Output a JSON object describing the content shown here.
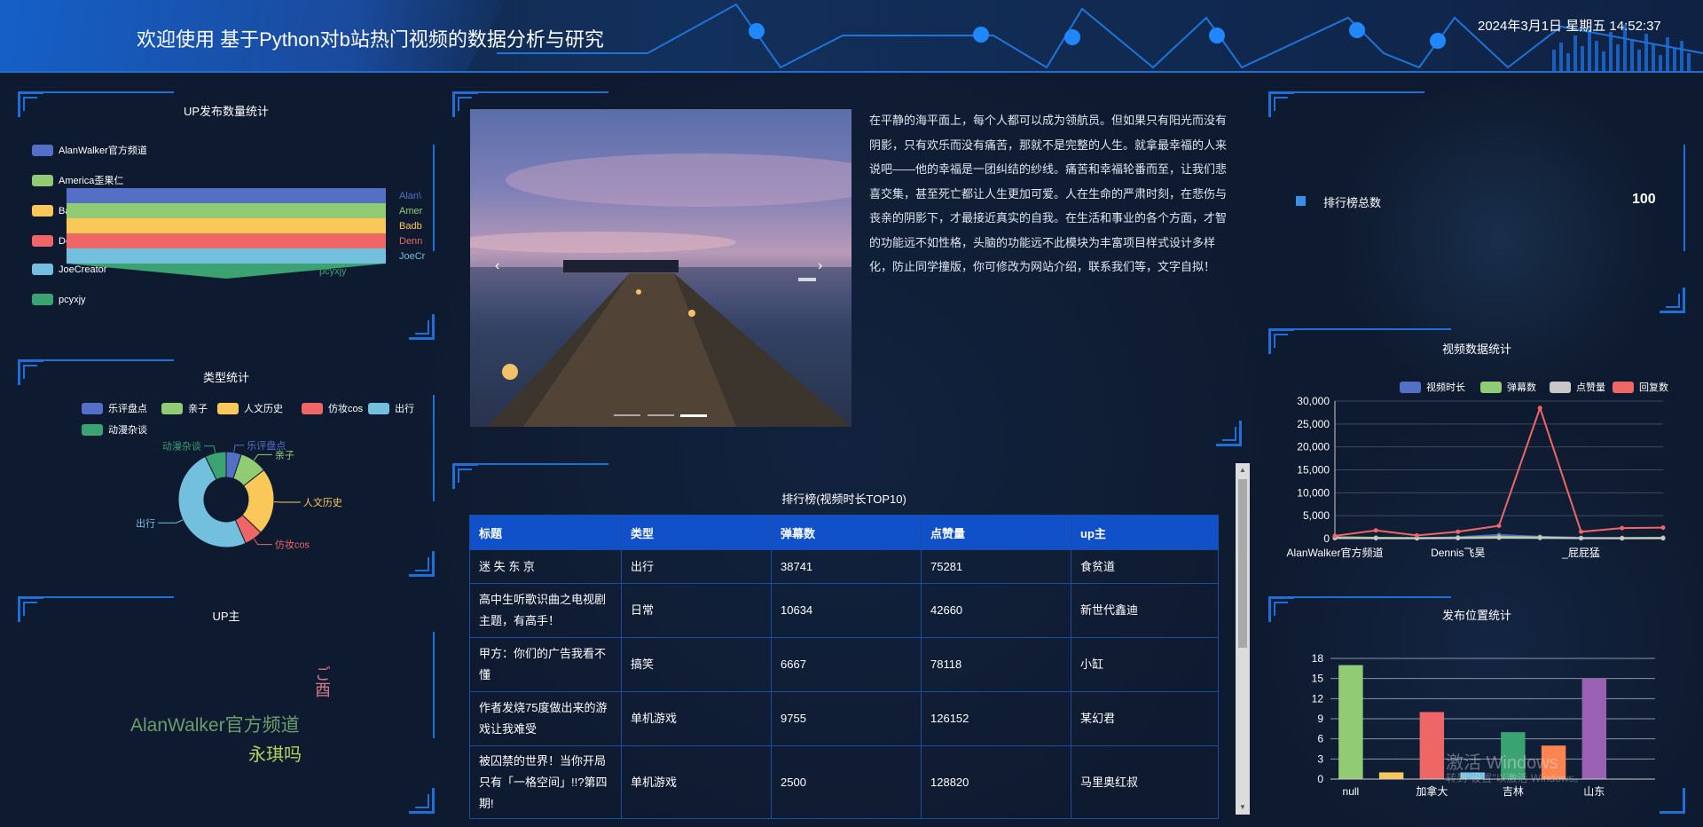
{
  "header": {
    "title": "欢迎使用 基于Python对b站热门视频的数据分析与研究",
    "datetime": "2024年3月1日 星期五 14:52:37"
  },
  "up_publish": {
    "title": "UP发布数量统计",
    "legend": [
      {
        "label": "AlanWalker官方频道",
        "color": "#5470c6"
      },
      {
        "label": "America歪果仁",
        "color": "#91cc75"
      },
      {
        "label": "Badboy猫主",
        "color": "#fac858"
      },
      {
        "label": "Dennis 飞昊",
        "color": "#ee6666"
      },
      {
        "label": "JoeCreator",
        "color": "#73c0de"
      },
      {
        "label": "pcyxjy",
        "color": "#3ba272"
      }
    ],
    "funnel_labels": [
      "Alan\\",
      "Amer",
      "Badb",
      "Denn",
      "JoeCr",
      "pcyxjy"
    ]
  },
  "type_stats": {
    "title": "类型统计",
    "legend": [
      {
        "label": "乐评盘点",
        "color": "#5470c6"
      },
      {
        "label": "亲子",
        "color": "#91cc75"
      },
      {
        "label": "人文历史",
        "color": "#fac858"
      },
      {
        "label": "仿妆cos",
        "color": "#ee6666"
      },
      {
        "label": "出行",
        "color": "#73c0de"
      },
      {
        "label": "动漫杂谈",
        "color": "#3ba272"
      }
    ],
    "chart_data": {
      "type": "pie",
      "labels": [
        "乐评盘点",
        "亲子",
        "人文历史",
        "仿妆cos",
        "出行",
        "动漫杂谈"
      ],
      "values": [
        5,
        9,
        22,
        6,
        48,
        7
      ],
      "colors": [
        "#5470c6",
        "#91cc75",
        "#fac858",
        "#ee6666",
        "#73c0de",
        "#3ba272"
      ]
    }
  },
  "up_main": {
    "title": "UP主",
    "words": [
      {
        "text": "AlanWalker官方频道",
        "color": "#6a9d6a"
      },
      {
        "text": "永琪吗",
        "color": "#b7d25a"
      },
      {
        "text": "ご酉",
        "color": "#d67a86"
      }
    ]
  },
  "intro": {
    "text": "在平静的海平面上，每个人都可以成为领航员。但如果只有阳光而没有阴影，只有欢乐而没有痛苦，那就不是完整的人生。就拿最幸福的人来说吧——他的幸福是一团纠结的纱线。痛苦和幸福轮番而至，让我们悲喜交集，甚至死亡都让人生更加可爱。人在生命的严肃时刻，在悲伤与丧亲的阴影下，才最接近真实的自我。在生活和事业的各个方面，才智的功能远不如性格，头脑的功能远不此模块为丰富项目样式设计多样化，防止同学撞版，你可修改为网站介绍，联系我们等，文字自拟！",
    "carousel_prev": "‹",
    "carousel_next": "›"
  },
  "ranking_total": {
    "label": "排行榜总数",
    "value": "100"
  },
  "ranking_table": {
    "title": "排行榜(视频时长TOP10)",
    "columns": [
      "标题",
      "类型",
      "弹幕数",
      "点赞量",
      "up主"
    ],
    "rows": [
      [
        "迷 失 东 京",
        "出行",
        "38741",
        "75281",
        "食贫道"
      ],
      [
        "高中生听歌识曲之电视剧主题，有高手！",
        "日常",
        "10634",
        "42660",
        "新世代鑫迪"
      ],
      [
        "甲方：你们的广告我看不懂",
        "搞笑",
        "6667",
        "78118",
        "小缸"
      ],
      [
        "作者发烧75度做出来的游戏让我难受",
        "单机游戏",
        "9755",
        "126152",
        "某幻君"
      ],
      [
        "被囚禁的世界！当你开局只有「一格空间」!!?第四期!",
        "单机游戏",
        "2500",
        "128820",
        "马里奥红叔"
      ]
    ]
  },
  "video_stats": {
    "title": "视频数据统计",
    "chart_data": {
      "type": "line",
      "categories": [
        "AlanWalker官方频道",
        "",
        "",
        "Dennis飞昊",
        "",
        "",
        "_屁屁猛",
        "",
        ""
      ],
      "x_tick_labels": [
        "AlanWalker官方频道",
        "Dennis飞昊",
        "_屁屁猛"
      ],
      "y_ticks": [
        "0",
        "5,000",
        "10,000",
        "15,000",
        "20,000",
        "25,000",
        "30,000"
      ],
      "ylim": [
        0,
        30000
      ],
      "series": [
        {
          "name": "视频时长",
          "color": "#5470c6",
          "values": [
            200,
            150,
            100,
            300,
            800,
            400,
            200,
            100,
            150
          ]
        },
        {
          "name": "弹幕数",
          "color": "#91cc75",
          "values": [
            300,
            200,
            150,
            200,
            400,
            300,
            100,
            150,
            200
          ]
        },
        {
          "name": "点赞量",
          "color": "#c8c8c8",
          "values": [
            100,
            80,
            60,
            100,
            200,
            150,
            80,
            60,
            80
          ]
        },
        {
          "name": "回复数",
          "color": "#ee6666",
          "values": [
            600,
            1800,
            700,
            1500,
            2800,
            28500,
            1500,
            2300,
            2400
          ]
        }
      ]
    }
  },
  "location_stats": {
    "title": "发布位置统计",
    "chart_data": {
      "type": "bar",
      "categories": [
        "null",
        "",
        "加拿大",
        "",
        "吉林",
        "",
        "山东",
        ""
      ],
      "x_tick_labels": [
        "null",
        "加拿大",
        "吉林",
        "山东"
      ],
      "values": [
        17,
        1,
        10,
        1,
        7,
        5,
        15,
        0
      ],
      "colors": [
        "#91cc75",
        "#fac858",
        "#ee6666",
        "#73c0de",
        "#3ba272",
        "#fc8452",
        "#9a60b4",
        "#ea7ccc"
      ],
      "y_ticks": [
        "0",
        "3",
        "6",
        "9",
        "12",
        "15",
        "18"
      ],
      "ylim": [
        0,
        18
      ]
    }
  },
  "watermark": {
    "line1": "激活 Windows",
    "line2": "转到\"设置\"以激活 Windows。"
  }
}
